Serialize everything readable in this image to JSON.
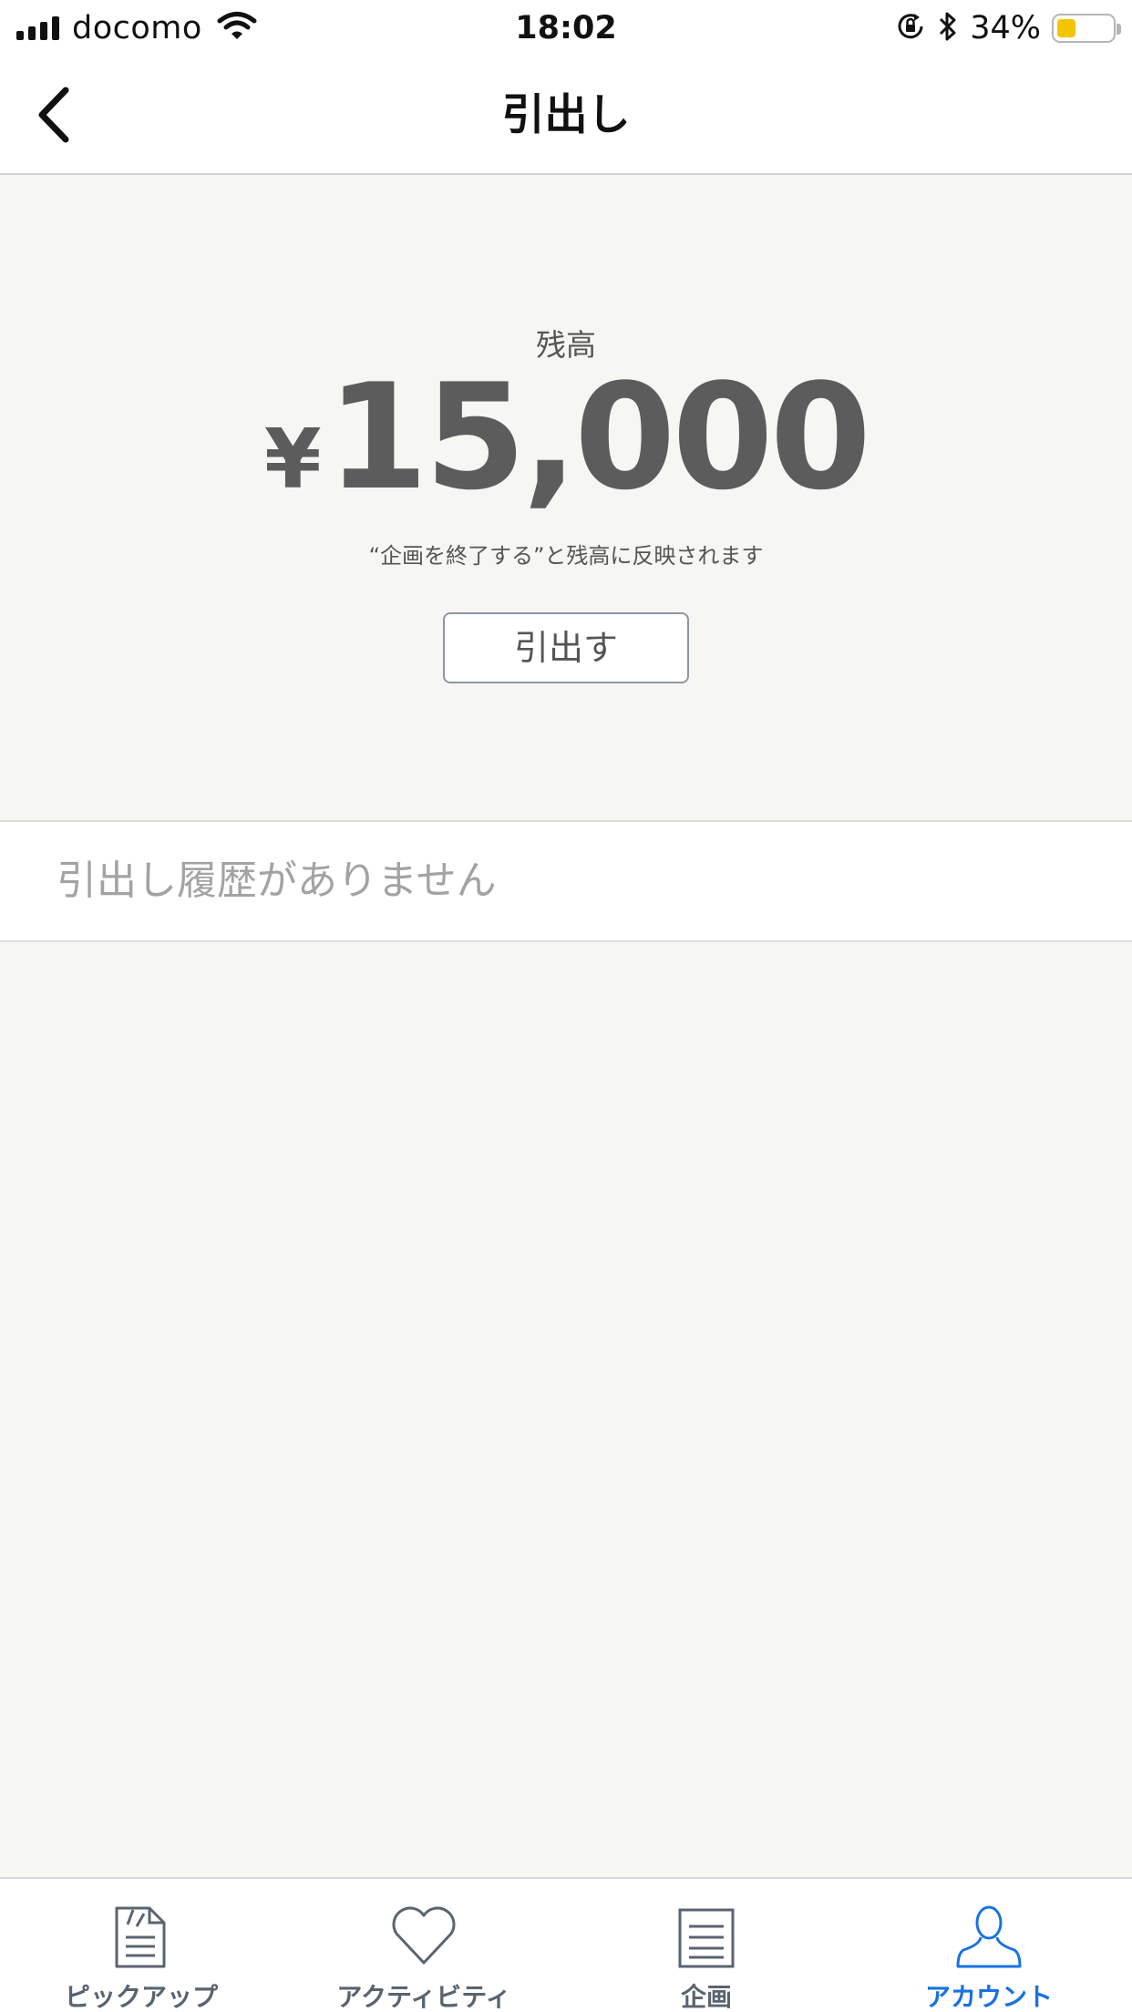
{
  "status_bar": {
    "carrier": "docomo",
    "time": "18:02",
    "battery_percent": "34%",
    "battery_level": 0.34,
    "icons": [
      "signal-icon",
      "wifi-icon",
      "orientation-lock-icon",
      "bluetooth-icon",
      "battery-icon"
    ]
  },
  "nav": {
    "title": "引出し",
    "back_icon": "chevron-left-icon"
  },
  "balance": {
    "label": "残高",
    "currency": "¥",
    "amount": "15,000",
    "note": "“企画を終了する”と残高に反映されます",
    "withdraw_button": "引出す"
  },
  "history": {
    "empty_message": "引出し履歴がありません"
  },
  "tab_bar": {
    "accent_color": "#1a72e0",
    "inactive_color": "#5a6470",
    "tabs": [
      {
        "label": "ピックアップ",
        "icon": "document-icon",
        "active": false
      },
      {
        "label": "アクティビティ",
        "icon": "heart-icon",
        "active": false
      },
      {
        "label": "企画",
        "icon": "list-icon",
        "active": false
      },
      {
        "label": "アカウント",
        "icon": "person-icon",
        "active": true
      }
    ]
  }
}
